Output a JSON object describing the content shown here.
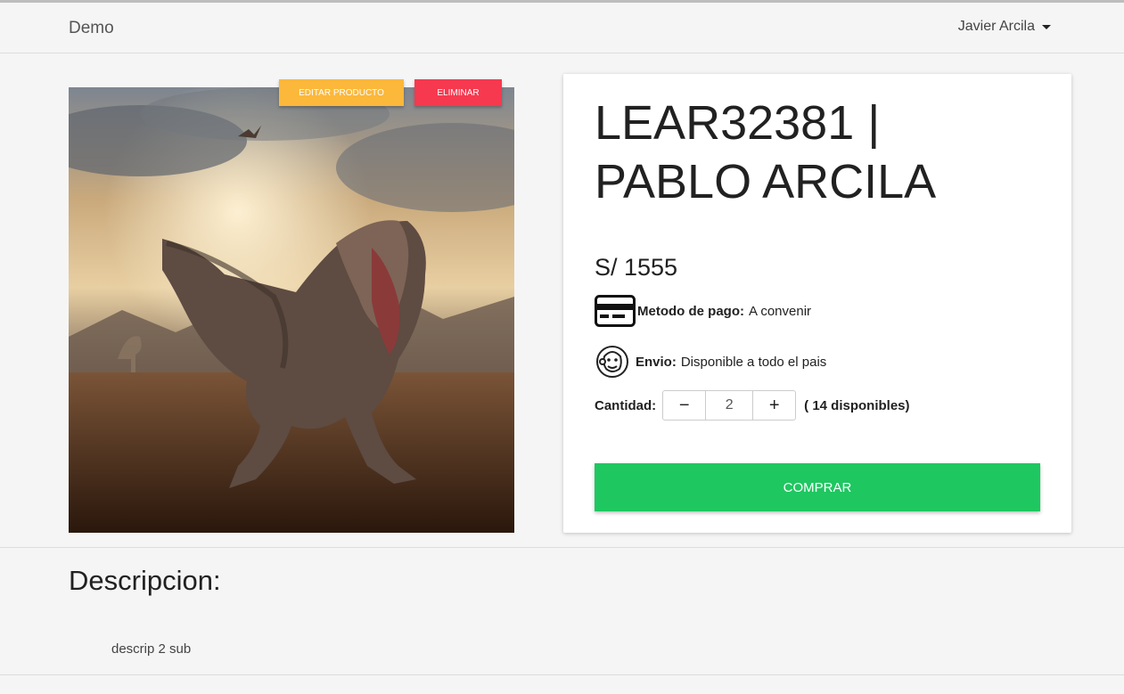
{
  "navbar": {
    "brand": "Demo",
    "user_name": "Javier Arcila"
  },
  "product": {
    "image_icon": "dinosaur-photo",
    "edit_label": "EDITAR PRODUCTO",
    "delete_label": "ELIMINAR",
    "title": "LEAR32381 | PABLO ARCILA",
    "price": "S/ 1555",
    "payment_label": "Metodo de pago:",
    "payment_value": "A convenir",
    "payment_icon": "credit-card-icon",
    "shipping_label": "Envio:",
    "shipping_value": "Disponible a todo el pais",
    "shipping_icon": "mailchimp-monkey-icon",
    "quantity_label": "Cantidad:",
    "quantity_minus": "−",
    "quantity_value": "2",
    "quantity_plus": "+",
    "availability": "( 14 disponibles)",
    "buy_label": "COMPRAR"
  },
  "description": {
    "title": "Descripcion:",
    "text": "descrip 2 sub"
  },
  "colors": {
    "edit_button": "#fbb83a",
    "delete_button": "#f6394f",
    "buy_button": "#1ec760"
  }
}
